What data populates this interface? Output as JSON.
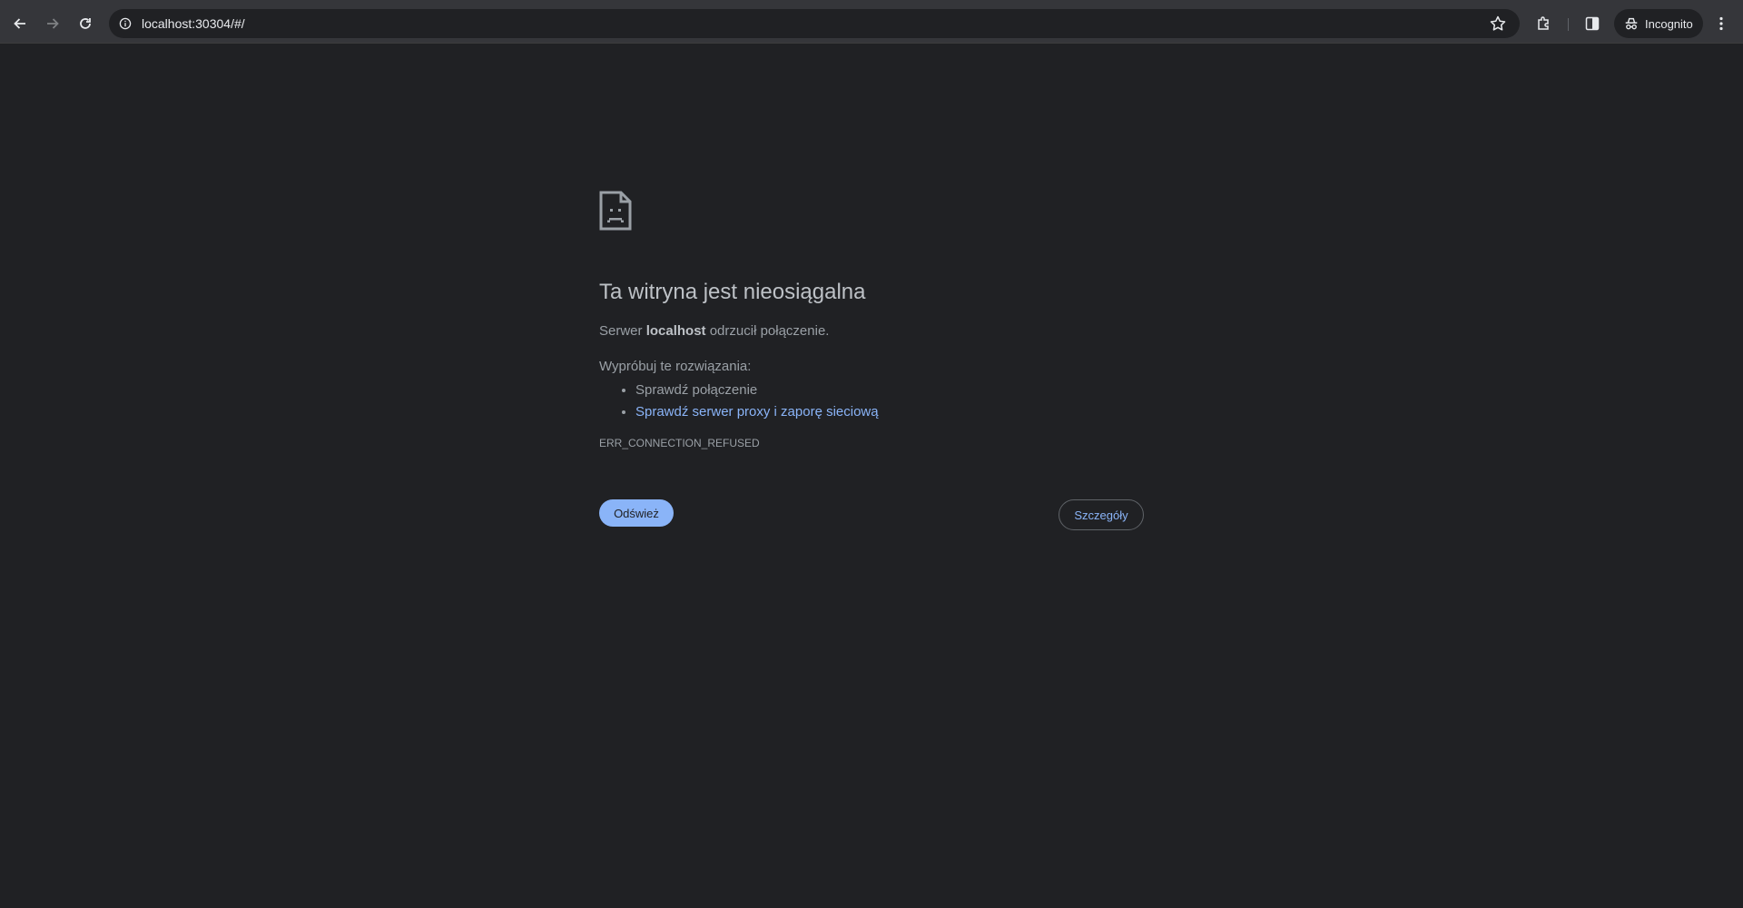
{
  "browser": {
    "url": "localhost:30304/#/",
    "incognito_label": "Incognito",
    "icons": [
      "back-icon",
      "forward-icon",
      "reload-icon",
      "info-icon",
      "star-icon",
      "extensions-icon",
      "side-panel-icon",
      "incognito-icon",
      "menu-icon"
    ]
  },
  "error_page": {
    "icon": "sad-page-icon",
    "heading": "Ta witryna jest nieosiągalna",
    "message_prefix": "Serwer",
    "message_host": "localhost",
    "message_suffix": "odrzucił połączenie.",
    "suggestions_title": "Wypróbuj te rozwiązania:",
    "suggestions": [
      "Sprawdź połączenie",
      "Sprawdź serwer proxy i zaporę sieciową"
    ],
    "error_code": "ERR_CONNECTION_REFUSED",
    "reload_label": "Odśwież",
    "details_label": "Szczegóły"
  },
  "colors": {
    "page_bg": "#202124",
    "toolbar_bg": "#35363a",
    "link": "#8ab4f8",
    "text": "#9aa0a6"
  }
}
